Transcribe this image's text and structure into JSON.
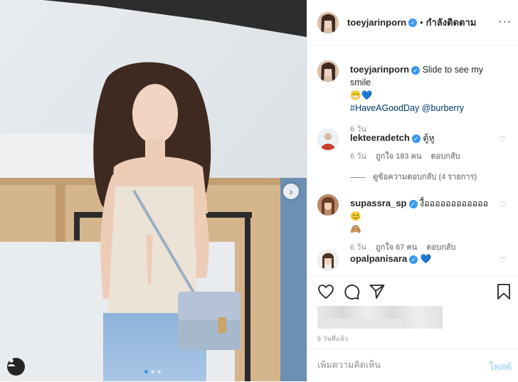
{
  "header": {
    "username": "toeyjarinporn",
    "separator": "•",
    "follow_label": "กำลังติดตาม",
    "more_label": "···"
  },
  "caption": {
    "username": "toeyjarinporn",
    "text": "Slide to see my smile",
    "emoji": "😁💙",
    "hashtag": "#HaveAGoodDay",
    "mention": "@burberry",
    "age": "6 วัน"
  },
  "comments": [
    {
      "username": "lekteeradetch",
      "text": "ตู้หู",
      "age": "6 วัน",
      "likes": "ถูกใจ 183 คน",
      "reply": "ตอบกลับ",
      "view_replies": "ดูข้อความตอบกลับ (4 รายการ)"
    },
    {
      "username": "supassra_sp",
      "text": "งื้ออออออออออออ😊",
      "text2": "🙈",
      "age": "6 วัน",
      "likes": "ถูกใจ 67 คน",
      "reply": "ตอบกลับ"
    },
    {
      "username": "opalpanisara",
      "text": "💙"
    }
  ],
  "post": {
    "posted_ago": "6 วันที่แล้ว",
    "comment_placeholder": "เพิ่มความคิดเห็น",
    "post_label": "โพสต์",
    "carousel_dots": 3,
    "carousel_active": 1
  },
  "colors": {
    "accent": "#3897f0",
    "text": "#262626",
    "muted": "#8e8e8e",
    "post_disabled": "#b3dbff"
  },
  "icons": [
    "verified-badge-icon",
    "heart-icon",
    "comment-icon",
    "share-icon",
    "bookmark-icon",
    "chevron-right-icon",
    "user-tag-icon",
    "more-icon"
  ]
}
